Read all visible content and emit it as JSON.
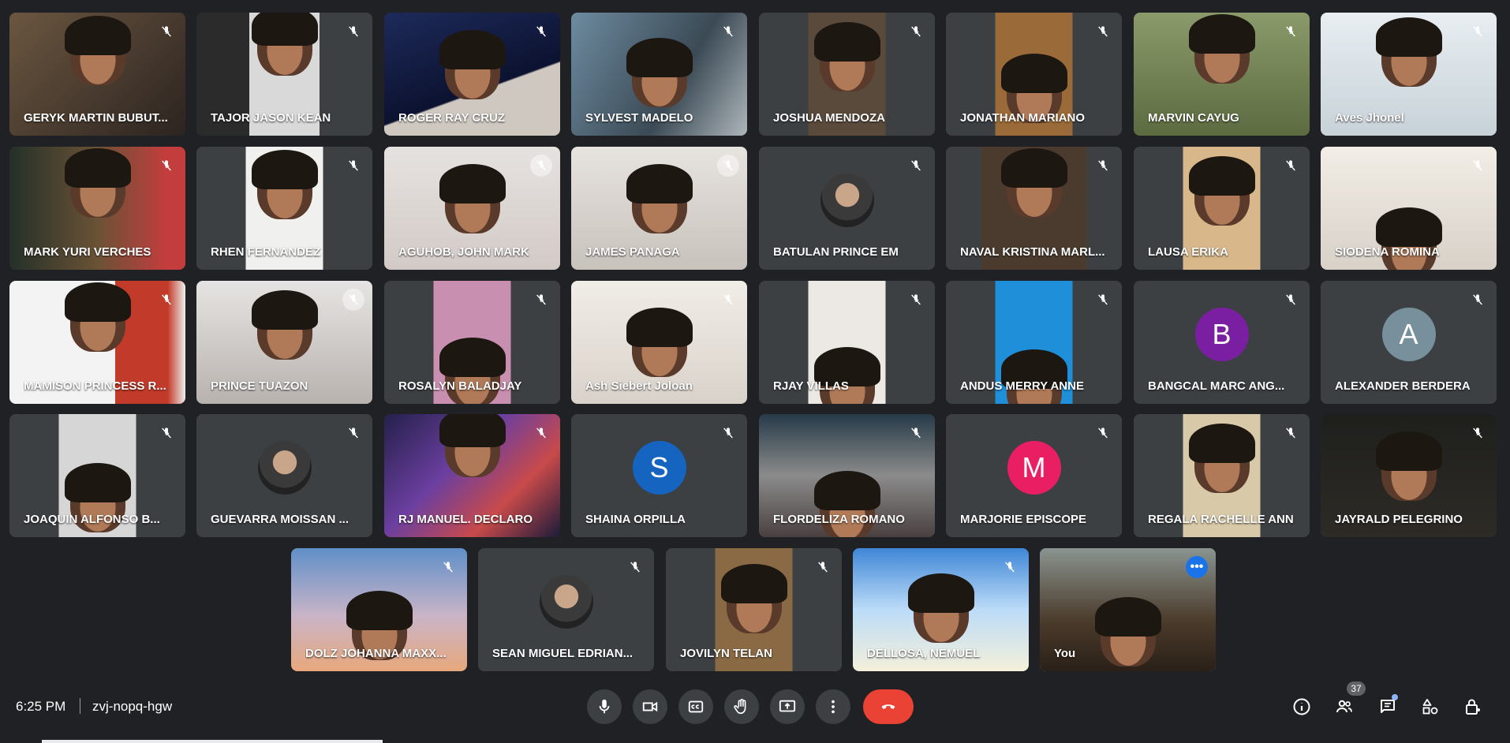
{
  "participants": [
    {
      "name": "GERYK MARTIN BUBUT..."
    },
    {
      "name": "TAJOR JASON KEAN"
    },
    {
      "name": "ROGER RAY CRUZ"
    },
    {
      "name": "SYLVEST MADELO"
    },
    {
      "name": "JOSHUA MENDOZA"
    },
    {
      "name": "JONATHAN MARIANO"
    },
    {
      "name": "MARVIN CAYUG"
    },
    {
      "name": "Aves Jhonel"
    },
    {
      "name": "MARK YURI VERCHES"
    },
    {
      "name": "RHEN FERNANDEZ"
    },
    {
      "name": "AGUHOB, JOHN MARK"
    },
    {
      "name": "JAMES PANAGA"
    },
    {
      "name": "BATULAN PRINCE EM"
    },
    {
      "name": "NAVAL KRISTINA MARL..."
    },
    {
      "name": "LAUSA ERIKA"
    },
    {
      "name": "SIODENA ROMINA"
    },
    {
      "name": "MAMISON PRINCESS R..."
    },
    {
      "name": "PRINCE TUAZON"
    },
    {
      "name": "ROSALYN BALADJAY"
    },
    {
      "name": "Ash Siebert Joloan"
    },
    {
      "name": "RJAY VILLAS"
    },
    {
      "name": "ANDUS MERRY ANNE"
    },
    {
      "name": "BANGCAL MARC ANG...",
      "initial": "B",
      "color": "#7b1fa2"
    },
    {
      "name": "ALEXANDER BERDERA",
      "initial": "A",
      "color": "#78909c"
    },
    {
      "name": "JOAQUIN ALFONSO B..."
    },
    {
      "name": "GUEVARRA MOISSAN ..."
    },
    {
      "name": "RJ MANUEL. DECLARO"
    },
    {
      "name": "SHAINA ORPILLA",
      "initial": "S",
      "color": "#1565c0"
    },
    {
      "name": "FLORDELIZA ROMANO"
    },
    {
      "name": "MARJORIE EPISCOPE",
      "initial": "M",
      "color": "#e91e63"
    },
    {
      "name": "REGALA RACHELLE ANN"
    },
    {
      "name": "JAYRALD PELEGRINO"
    },
    {
      "name": "DOLZ JOHANNA MAXX..."
    },
    {
      "name": "SEAN MIGUEL EDRIAN..."
    },
    {
      "name": "JOVILYN TELAN"
    },
    {
      "name": "DELLOSA, NEMUEL"
    },
    {
      "name": "You"
    }
  ],
  "meeting": {
    "time": "6:25 PM",
    "code": "zvj-nopq-hgw",
    "participant_count": "37"
  },
  "controls": {
    "more_options_glyph": "•••"
  }
}
